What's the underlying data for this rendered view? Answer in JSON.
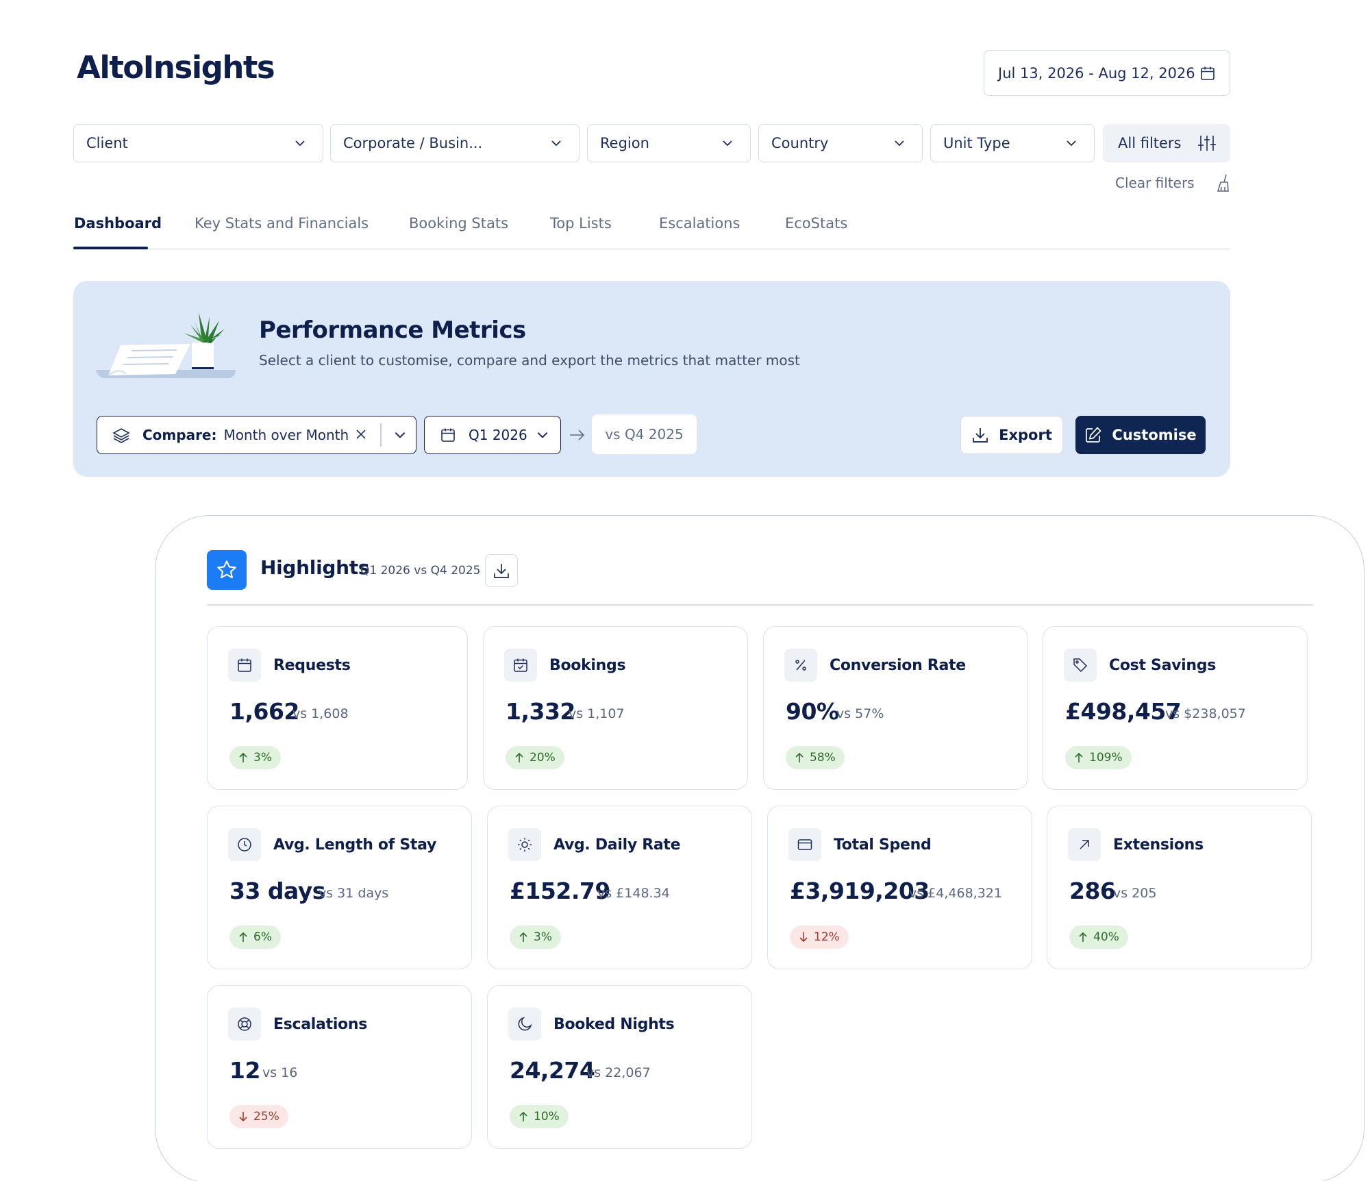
{
  "app": {
    "logo": "AltoInsights"
  },
  "date_range": {
    "value": "Jul 13, 2026 - Aug 12, 2026",
    "icon": "calendar-icon"
  },
  "filters": [
    {
      "label": "Client"
    },
    {
      "label": "Corporate / Busin..."
    },
    {
      "label": "Region"
    },
    {
      "label": "Country"
    },
    {
      "label": "Unit Type"
    }
  ],
  "all_filters": {
    "label": "All filters",
    "icon": "sliders-icon"
  },
  "clear_filters": {
    "label": "Clear filters",
    "icon": "broom-icon"
  },
  "tabs": [
    {
      "label": "Dashboard",
      "active": true
    },
    {
      "label": "Key Stats and Financials"
    },
    {
      "label": "Booking Stats"
    },
    {
      "label": "Top Lists"
    },
    {
      "label": "Escalations"
    },
    {
      "label": "EcoStats"
    }
  ],
  "performance": {
    "title": "Performance Metrics",
    "subtitle": "Select a client to customise, compare and export the metrics that matter most",
    "compare_label": "Compare:",
    "compare_value": "Month over Month",
    "period": "Q1 2026",
    "vs_period": "vs Q4 2025",
    "export_label": "Export",
    "customise_label": "Customise"
  },
  "highlights": {
    "title": "Highlights",
    "subtitle": "Q1 2026 vs Q4 2025",
    "cards": [
      {
        "title": "Requests",
        "icon": "calendar-icon",
        "value": "1,662",
        "compare": "vs 1,608",
        "change": "3%",
        "direction": "up"
      },
      {
        "title": "Bookings",
        "icon": "calendar-check-icon",
        "value": "1,332",
        "compare": "vs 1,107",
        "change": "20%",
        "direction": "up"
      },
      {
        "title": "Conversion Rate",
        "icon": "percent-icon",
        "value": "90%",
        "compare": "vs 57%",
        "change": "58%",
        "direction": "up"
      },
      {
        "title": "Cost Savings",
        "icon": "tag-icon",
        "value": "£498,457",
        "compare": "vs $238,057",
        "change": "109%",
        "direction": "up"
      },
      {
        "title": "Avg. Length of Stay",
        "icon": "clock-icon",
        "value": "33 days",
        "compare": "vs 31 days",
        "change": "6%",
        "direction": "up"
      },
      {
        "title": "Avg. Daily Rate",
        "icon": "sun-icon",
        "value": "£152.79",
        "compare": "vs £148.34",
        "change": "3%",
        "direction": "up"
      },
      {
        "title": "Total Spend",
        "icon": "credit-card-icon",
        "value": "£3,919,203",
        "compare": "vs £4,468,321",
        "change": "12%",
        "direction": "down"
      },
      {
        "title": "Extensions",
        "icon": "arrow-up-right-icon",
        "value": "286",
        "compare": "vs 205",
        "change": "40%",
        "direction": "up"
      },
      {
        "title": "Escalations",
        "icon": "lifebuoy-icon",
        "value": "12",
        "compare": "vs 16",
        "change": "25%",
        "direction": "down"
      },
      {
        "title": "Booked Nights",
        "icon": "moon-icon",
        "value": "24,274",
        "compare": "vs 22,067",
        "change": "10%",
        "direction": "up"
      }
    ]
  },
  "colors": {
    "navy": "#0f1f4b",
    "accent_blue": "#1b7cf5",
    "panel_bg": "#dce8f8",
    "up_bg": "#e1f3de",
    "down_bg": "#fbe7e5"
  }
}
